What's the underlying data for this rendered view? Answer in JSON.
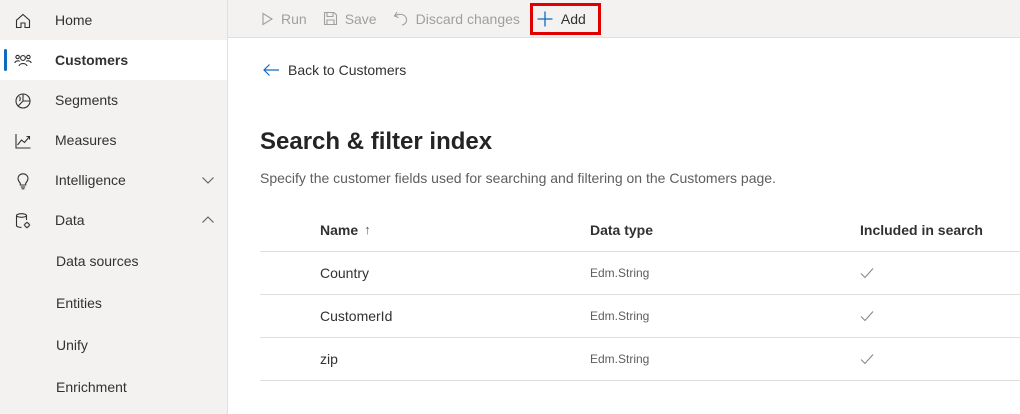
{
  "sidebar": {
    "items": [
      {
        "label": "Home",
        "icon": "home-icon"
      },
      {
        "label": "Customers",
        "icon": "people-icon",
        "active": true
      },
      {
        "label": "Segments",
        "icon": "segments-icon"
      },
      {
        "label": "Measures",
        "icon": "chart-line-icon"
      },
      {
        "label": "Intelligence",
        "icon": "lightbulb-icon",
        "expandable": "chevron-down"
      },
      {
        "label": "Data",
        "icon": "database-icon",
        "expandable": "chevron-up"
      }
    ],
    "data_children": [
      "Data sources",
      "Entities",
      "Unify",
      "Enrichment"
    ]
  },
  "toolbar": {
    "run": "Run",
    "save": "Save",
    "discard": "Discard changes",
    "add": "Add"
  },
  "main": {
    "back_link": "Back to Customers",
    "title": "Search & filter index",
    "description": "Specify the customer fields used for searching and filtering on the Customers page.",
    "table": {
      "headers": {
        "name": "Name",
        "sort_indicator": "↑",
        "data_type": "Data type",
        "included": "Included in search"
      },
      "rows": [
        {
          "name": "Country",
          "data_type": "Edm.String",
          "included": true
        },
        {
          "name": "CustomerId",
          "data_type": "Edm.String",
          "included": true
        },
        {
          "name": "zip",
          "data_type": "Edm.String",
          "included": true
        }
      ]
    }
  },
  "colors": {
    "accent": "#0f6cbd",
    "highlight_box": "#e00000",
    "sidebar_bg": "#f3f2f1"
  }
}
